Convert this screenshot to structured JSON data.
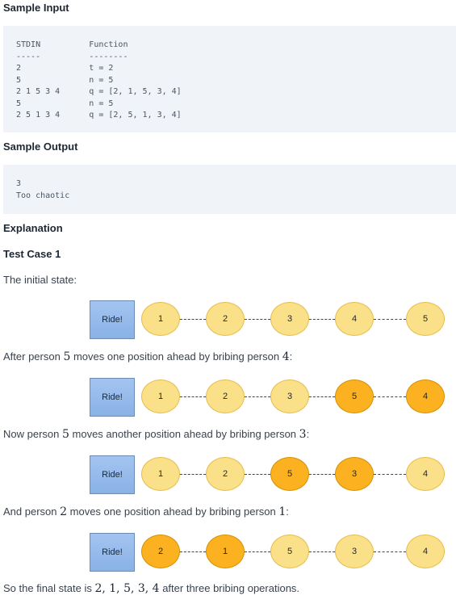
{
  "sample_input": {
    "heading": "Sample Input",
    "code": "STDIN          Function\n-----          --------\n2              t = 2\n5              n = 5\n2 1 5 3 4      q = [2, 1, 5, 3, 4]\n5              n = 5\n2 5 1 3 4      q = [2, 5, 1, 3, 4]"
  },
  "sample_output": {
    "heading": "Sample Output",
    "code": "3\nToo chaotic"
  },
  "explanation": {
    "heading": "Explanation",
    "test_case": "Test Case 1"
  },
  "steps": [
    {
      "caption": [
        "The initial state:"
      ],
      "ride_label": "Ride!",
      "people": [
        {
          "n": "1",
          "moved": false
        },
        {
          "n": "2",
          "moved": false
        },
        {
          "n": "3",
          "moved": false
        },
        {
          "n": "4",
          "moved": false
        },
        {
          "n": "5",
          "moved": false
        }
      ]
    },
    {
      "caption": [
        "After person ",
        "5",
        " moves one position ahead by bribing person ",
        "4",
        ":"
      ],
      "ride_label": "Ride!",
      "people": [
        {
          "n": "1",
          "moved": false
        },
        {
          "n": "2",
          "moved": false
        },
        {
          "n": "3",
          "moved": false
        },
        {
          "n": "5",
          "moved": true
        },
        {
          "n": "4",
          "moved": true
        }
      ]
    },
    {
      "caption": [
        "Now person ",
        "5",
        " moves another position ahead by bribing person ",
        "3",
        ":"
      ],
      "ride_label": "Ride!",
      "people": [
        {
          "n": "1",
          "moved": false
        },
        {
          "n": "2",
          "moved": false
        },
        {
          "n": "5",
          "moved": true
        },
        {
          "n": "3",
          "moved": true
        },
        {
          "n": "4",
          "moved": false
        }
      ]
    },
    {
      "caption": [
        "And person ",
        "2",
        " moves one position ahead by bribing person ",
        "1",
        ":"
      ],
      "ride_label": "Ride!",
      "people": [
        {
          "n": "2",
          "moved": true
        },
        {
          "n": "1",
          "moved": true
        },
        {
          "n": "5",
          "moved": false
        },
        {
          "n": "3",
          "moved": false
        },
        {
          "n": "4",
          "moved": false
        }
      ]
    }
  ],
  "final": [
    "So the final state is ",
    "2, 1, 5, 3, 4",
    " after three bribing operations."
  ]
}
